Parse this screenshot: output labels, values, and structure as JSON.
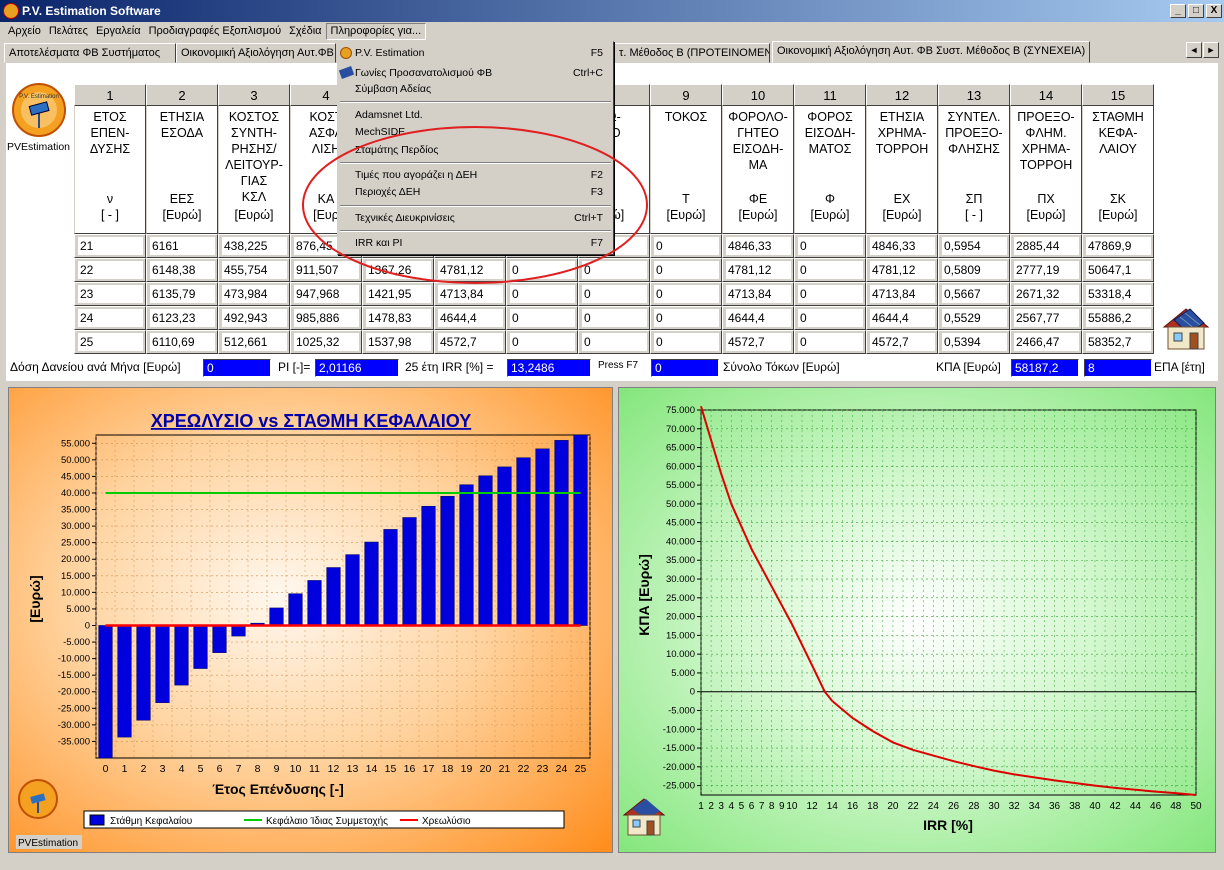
{
  "window": {
    "title": "P.V. Estimation Software",
    "min": "_",
    "max": "□",
    "close": "X"
  },
  "menu": [
    "Αρχείο",
    "Πελάτες",
    "Εργαλεία",
    "Προδιαγραφές Εξοπλισμού",
    "Σχέδια",
    "Πληροφορίες για..."
  ],
  "tabs": [
    "Αποτελέσματα ΦΒ Συστήματος",
    "Οικονομική Αξιολόγηση Αυτ.ΦΒ",
    "τ. Μέθοδος Β (ΠΡΟΤΕΙΝΟΜΕΝΗ)",
    "Οικονομική Αξιολόγηση Αυτ. ΦΒ Συστ. Μέθοδος Β (ΣΥΝΕΧΕΙΑ)"
  ],
  "tab_nav": {
    "left": "◄",
    "right": "►"
  },
  "dropdown": {
    "items": [
      {
        "label": "P.V. Estimation",
        "shortcut": "F5"
      },
      {
        "label": "Γωνίες Προσανατολισμού ΦΒ",
        "shortcut": "Ctrl+C"
      },
      {
        "label": "Σύμβαση Αδείας",
        "shortcut": ""
      },
      {
        "label": "Adamsnet Ltd.",
        "shortcut": ""
      },
      {
        "label": "MechSIDE",
        "shortcut": ""
      },
      {
        "label": "Σταμάτης Περδίος",
        "shortcut": ""
      },
      {
        "label": "Τιμές που αγοράζει η ΔΕΗ",
        "shortcut": "F2"
      },
      {
        "label": "Περιοχές ΔΕΗ",
        "shortcut": "F3"
      },
      {
        "label": "Τεχνικές Διευκρινίσεις",
        "shortcut": "Ctrl+T"
      },
      {
        "label": "IRR και PI",
        "shortcut": "F7"
      }
    ]
  },
  "logo_label": "PVEstimation",
  "logo_small": "P.V. Estimation",
  "grid": {
    "col_numbers": [
      "1",
      "2",
      "3",
      "4",
      "",
      "",
      "",
      "",
      "9",
      "10",
      "11",
      "12",
      "13",
      "14",
      "15"
    ],
    "headers": [
      {
        "title": "ΕΤΟΣ\nΕΠΕΝ-\nΔΥΣΗΣ",
        "symbol": "ν\n[ - ]"
      },
      {
        "title": "ΕΤΗΣΙΑ\nΕΣΟΔΑ",
        "symbol": "ΕΕΣ\n[Ευρώ]"
      },
      {
        "title": "ΚΟΣΤΟΣ\nΣΥΝΤΗ-\nΡΗΣΗΣ/\nΛΕΙΤΟΥΡ-\nΓΙΑΣ\nΚΣΛ",
        "symbol": "[Ευρώ]"
      },
      {
        "title": "ΚΟΣΤ\nΑΣΦΑ\nΛΙΣΗ",
        "symbol": "ΚΑ\n[Ευρ"
      },
      {
        "title": "",
        "symbol": ""
      },
      {
        "title": "",
        "symbol": ""
      },
      {
        "title": "",
        "symbol": ""
      },
      {
        "title": "Ω-\nΙΟ",
        "symbol": "\nρώ]"
      },
      {
        "title": "ΤΟΚΟΣ",
        "symbol": "Τ\n[Ευρώ]"
      },
      {
        "title": "ΦΟΡΟΛΟ-\nΓΗΤΕΟ\nΕΙΣΟΔΗ-\nΜΑ",
        "symbol": "ΦΕ\n[Ευρώ]"
      },
      {
        "title": "ΦΟΡΟΣ\nΕΙΣΟΔΗ-\nΜΑΤΟΣ",
        "symbol": "Φ\n[Ευρώ]"
      },
      {
        "title": "ΕΤΗΣΙΑ\nΧΡΗΜΑ-\nΤΟΡΡΟΗ",
        "symbol": "ΕΧ\n[Ευρώ]"
      },
      {
        "title": "ΣΥΝΤΕΛ.\nΠΡΟΕΞΟ-\nΦΛΗΣΗΣ",
        "symbol": "ΣΠ\n[ - ]"
      },
      {
        "title": "ΠΡΟΕΞΟ-\nΦΛΗΜ.\nΧΡΗΜΑ-\nΤΟΡΡΟΗ",
        "symbol": "ΠΧ\n[Ευρώ]"
      },
      {
        "title": "ΣΤΑΘΜΗ\nΚΕΦΑ-\nΛΑΙΟΥ",
        "symbol": "ΣΚ\n[Ευρώ]"
      }
    ],
    "rows": [
      [
        "21",
        "6161",
        "438,225",
        "876,45",
        "",
        "",
        "",
        "",
        "0",
        "4846,33",
        "0",
        "4846,33",
        "0,5954",
        "2885,44",
        "47869,9"
      ],
      [
        "22",
        "6148,38",
        "455,754",
        "911,507",
        "1367,26",
        "4781,12",
        "0",
        "0",
        "0",
        "4781,12",
        "0",
        "4781,12",
        "0,5809",
        "2777,19",
        "50647,1"
      ],
      [
        "23",
        "6135,79",
        "473,984",
        "947,968",
        "1421,95",
        "4713,84",
        "0",
        "0",
        "0",
        "4713,84",
        "0",
        "4713,84",
        "0,5667",
        "2671,32",
        "53318,4"
      ],
      [
        "24",
        "6123,23",
        "492,943",
        "985,886",
        "1478,83",
        "4644,4",
        "0",
        "0",
        "0",
        "4644,4",
        "0",
        "4644,4",
        "0,5529",
        "2567,77",
        "55886,2"
      ],
      [
        "25",
        "6110,69",
        "512,661",
        "1025,32",
        "1537,98",
        "4572,7",
        "0",
        "0",
        "0",
        "4572,7",
        "0",
        "4572,7",
        "0,5394",
        "2466,47",
        "58352,7"
      ]
    ]
  },
  "summary": {
    "loan_label": "Δόση Δανείου ανά Μήνα [Ευρώ]",
    "loan_value": "0",
    "pi_label": "PI [-]=",
    "pi_value": "2,01166",
    "irr_label": "25 έτη IRR [%] =",
    "irr_value": "13,2486",
    "press_f7": "Press F7",
    "interest_value": "0",
    "interest_label": "Σύνολο Τόκων [Ευρώ]",
    "kpa_label": "ΚΠΑ [Ευρώ]",
    "kpa_value": "58187,2",
    "epa_value": "8",
    "epa_label": "ΕΠΑ [έτη]"
  },
  "chart_data": [
    {
      "type": "bar",
      "title": "ΧΡΕΩΛΥΣΙΟ vs ΣΤΑΘΜΗ ΚΕΦΑΛΑΙΟΥ",
      "xlabel": "Έτος Επένδυσης [-]",
      "ylabel": "[Ευρώ]",
      "ylim": [
        -40000,
        57500
      ],
      "yticks": [
        55000,
        50000,
        45000,
        40000,
        35000,
        30000,
        25000,
        20000,
        15000,
        10000,
        5000,
        0,
        -5000,
        -10000,
        -15000,
        -20000,
        -25000,
        -30000,
        -35000
      ],
      "ytick_labels": [
        "55.000",
        "50.000",
        "45.000",
        "40.000",
        "35.000",
        "30.000",
        "25.000",
        "20.000",
        "15.000",
        "10.000",
        "5.000",
        "0",
        "-5.000",
        "-10.000",
        "-15.000",
        "-20.000",
        "-25.000",
        "-30.000",
        "-35.000"
      ],
      "categories": [
        "0",
        "1",
        "2",
        "3",
        "4",
        "5",
        "6",
        "7",
        "8",
        "9",
        "10",
        "11",
        "12",
        "13",
        "14",
        "15",
        "16",
        "17",
        "18",
        "19",
        "20",
        "21",
        "22",
        "23",
        "24",
        "25"
      ],
      "series": [
        {
          "name": "Στάθμη Κεφαλαίου",
          "type": "bar",
          "color": "#0000dd",
          "values": [
            -40000,
            -33700,
            -28600,
            -23300,
            -18000,
            -13000,
            -8200,
            -3200,
            700,
            5300,
            9600,
            13600,
            17500,
            21400,
            25200,
            29000,
            32600,
            36000,
            39000,
            42500,
            45200,
            47869.9,
            50647.1,
            53318.4,
            55886.2,
            58352.7
          ]
        },
        {
          "name": "Κεφάλαιο Ίδιας Συμμετοχής",
          "type": "line",
          "color": "#00cc00",
          "values": [
            40000,
            40000,
            40000,
            40000,
            40000,
            40000,
            40000,
            40000,
            40000,
            40000,
            40000,
            40000,
            40000,
            40000,
            40000,
            40000,
            40000,
            40000,
            40000,
            40000,
            40000,
            40000,
            40000,
            40000,
            40000,
            40000
          ]
        },
        {
          "name": "Χρεωλύσιο",
          "type": "line",
          "color": "#ff0000",
          "values": [
            0,
            0,
            0,
            0,
            0,
            0,
            0,
            0,
            0,
            0,
            0,
            0,
            0,
            0,
            0,
            0,
            0,
            0,
            0,
            0,
            0,
            0,
            0,
            0,
            0,
            0
          ]
        }
      ],
      "legend": "bottom"
    },
    {
      "type": "line",
      "xlabel": "IRR [%]",
      "ylabel": "ΚΠΑ [Ευρώ]",
      "xlim": [
        1,
        50
      ],
      "ylim": [
        -27500,
        75000
      ],
      "xticks": [
        1,
        2,
        3,
        4,
        5,
        6,
        7,
        8,
        9,
        10,
        12,
        14,
        16,
        18,
        20,
        22,
        24,
        26,
        28,
        30,
        32,
        34,
        36,
        38,
        40,
        42,
        44,
        46,
        48,
        50
      ],
      "yticks": [
        75000,
        70000,
        65000,
        60000,
        55000,
        50000,
        45000,
        40000,
        35000,
        30000,
        25000,
        20000,
        15000,
        10000,
        5000,
        0,
        -5000,
        -10000,
        -15000,
        -20000,
        -25000
      ],
      "ytick_labels": [
        "75.000",
        "70.000",
        "65.000",
        "60.000",
        "55.000",
        "50.000",
        "45.000",
        "40.000",
        "35.000",
        "30.000",
        "25.000",
        "20.000",
        "15.000",
        "10.000",
        "5.000",
        "0",
        "-5.000",
        "-10.000",
        "-15.000",
        "-20.000",
        "-25.000"
      ],
      "series": [
        {
          "color": "#dd0000",
          "x": [
            1,
            2,
            3,
            4,
            5,
            6,
            8,
            10,
            12,
            13.25,
            14,
            16,
            18,
            20,
            22,
            24,
            26,
            28,
            30,
            32,
            34,
            36,
            38,
            40,
            42,
            44,
            46,
            48,
            50
          ],
          "y": [
            76000,
            67000,
            58000,
            50000,
            44000,
            38000,
            28000,
            18000,
            7000,
            0,
            -2500,
            -7000,
            -10500,
            -13500,
            -15500,
            -17000,
            -18500,
            -19800,
            -21000,
            -22000,
            -22800,
            -23600,
            -24300,
            -25000,
            -25600,
            -26100,
            -26600,
            -27000,
            -27500
          ]
        }
      ],
      "grid": true
    }
  ]
}
